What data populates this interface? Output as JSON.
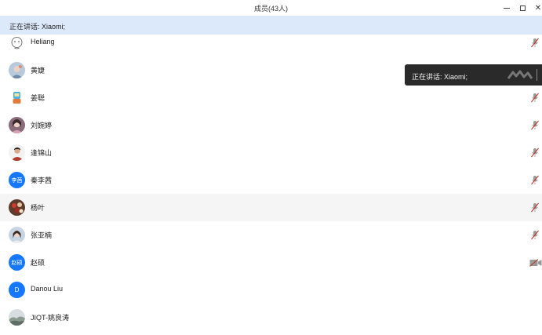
{
  "window": {
    "title": "成员(43人)",
    "minimize_glyph": "—",
    "maximize_glyph": "□",
    "close_glyph": "✕"
  },
  "speaking_bar": {
    "text": "正在讲话: Xiaomi;"
  },
  "toast": {
    "text": "正在讲话: Xiaomi;"
  },
  "colors": {
    "speaking_bar_bg": "#dce9fb",
    "avatar_blue": "#1677ff",
    "toast_bg": "#2a2a2a",
    "mic_muted": "#c0392b"
  },
  "members": [
    {
      "name": "Heliang",
      "avatar": "cartoon-face-avatar",
      "status": "mic-muted-icon"
    },
    {
      "name": "黄婕",
      "avatar": "photo-avatar",
      "status": ""
    },
    {
      "name": "姜聪",
      "avatar": "toy-avatar",
      "status": "mic-muted-icon"
    },
    {
      "name": "刘婉婷",
      "avatar": "photo-avatar",
      "status": "mic-muted-icon"
    },
    {
      "name": "逢锦山",
      "avatar": "photo-avatar",
      "status": "mic-muted-icon"
    },
    {
      "name": "秦李茜",
      "avatar_text": "李茜",
      "status": "mic-muted-icon"
    },
    {
      "name": "杨叶",
      "avatar": "photo-avatar",
      "status": "mic-muted-icon"
    },
    {
      "name": "张亚楠",
      "avatar": "photo-avatar",
      "status": "mic-muted-icon"
    },
    {
      "name": "赵硕",
      "avatar_text": "赵硕",
      "status": "camera-off-icon"
    },
    {
      "name": "Danou Liu",
      "avatar_text": "D",
      "status": ""
    },
    {
      "name": "JIQT-姚良涛",
      "avatar": "landscape-avatar",
      "status": ""
    }
  ]
}
